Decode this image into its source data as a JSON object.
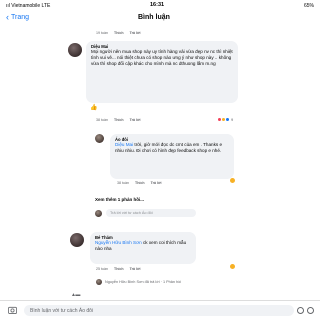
{
  "status_bar": {
    "carrier": "ııl Vietnamobile  LTE",
    "time": "16:31",
    "battery": "65%"
  },
  "nav": {
    "back_label": "Trang",
    "title": "Bình luận"
  },
  "top_meta": {
    "time": "19 tuần",
    "like": "Thích",
    "reply": "Trả lời"
  },
  "comments": [
    {
      "name": "Diệu Mai",
      "text": "Mọi người nên mua shop này uy tính hàng vải vừa đẹp nv nc thì nhiệt tình vui vẻ... nói thiệt chưa có shop nào ưng ý như shop này .. không vừa thì shop đổi cập khác cho mình mà nc dthuong lắm m.ng",
      "meta": {
        "time": "38 tuần",
        "like": "Thích",
        "reply": "Trả lời"
      },
      "reaction_count": "9"
    },
    {
      "name": "Áo đôi",
      "text_mention": "Diệu Mai",
      "text": " trời, giờ mới đọc dc cmt của em . Thanks e nhiu nhiu. Đi chơi có hình đẹp feedback shop e nhé.",
      "meta": {
        "time": "38 tuần",
        "like": "Thích",
        "reply": "Trả lời"
      }
    },
    {
      "name": "Bé Thảm",
      "text_mention": "Nguyễn Hữu Bình Sơn",
      "text": " ck xem coi thích mẫu nào nha",
      "meta": {
        "time": "25 tuần",
        "like": "Thích",
        "reply": "Trả lời"
      }
    }
  ],
  "view_more": "Xem thêm 1 phản hồi...",
  "reply_placeholder_1": "Trả lời với tư cách Áo đôi",
  "reply_preview": "Nguyễn Hữu Bình Sơn đã trả lời · 1 Phản hồi",
  "bottom_bar": {
    "placeholder": "Bình luận với tư cách Áo đôi"
  },
  "colors": {
    "link": "#1877f2",
    "bubble": "#f0f2f5",
    "meta": "#65676b"
  }
}
